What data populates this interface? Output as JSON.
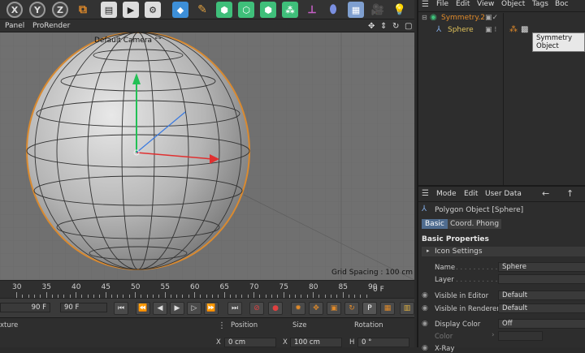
{
  "toolbar": {
    "axis_x": "X",
    "axis_y": "Y",
    "axis_z": "Z"
  },
  "view_header": {
    "panel": "Panel",
    "prorender": "ProRender",
    "camera": "Default Camera",
    "camera_mark": "°°"
  },
  "viewport": {
    "grid_spacing": "Grid Spacing : 100 cm"
  },
  "timeline": {
    "ticks": [
      "30",
      "35",
      "40",
      "45",
      "50",
      "55",
      "60",
      "65",
      "70",
      "75",
      "80",
      "85",
      "90"
    ],
    "end_frame": "0 F"
  },
  "transport": {
    "current_frame": "90 F",
    "end_frame": "90 F"
  },
  "coords": {
    "texture_label": "xture",
    "position": "Position",
    "size": "Size",
    "rotation": "Rotation",
    "x_label": "X",
    "pos_x": "0 cm",
    "x_label2": "X",
    "size_x": "100 cm",
    "h_label": "H",
    "rot_h": "0 °"
  },
  "object_manager": {
    "menu": [
      "File",
      "Edit",
      "View",
      "Object",
      "Tags",
      "Boc"
    ],
    "objects": [
      {
        "name": "Symmetry.2",
        "color": "#e08a2a"
      },
      {
        "name": "Sphere",
        "color": "#e0c25a"
      }
    ],
    "tooltip": "Symmetry Object"
  },
  "attribute_manager": {
    "menu": [
      "Mode",
      "Edit",
      "User Data"
    ],
    "object_title": "Polygon Object [Sphere]",
    "tabs": [
      "Basic",
      "Coord.",
      "Phong"
    ],
    "section": "Basic Properties",
    "icon_settings": "Icon Settings",
    "fields": [
      {
        "label": "Name",
        "dots": ". . . . . . . . . . .",
        "value": "Sphere"
      },
      {
        "label": "Layer",
        "dots": ". . . . . . . . . . .",
        "value": ""
      }
    ],
    "visible_editor_label": "Visible in Editor",
    "visible_editor_value": "Default",
    "visible_renderer_label": "Visible in Renderer",
    "visible_renderer_value": "Default",
    "display_color_label": "Display Color",
    "display_color_value": "Off",
    "color_label": "Color",
    "xray_label": "X-Ray"
  },
  "colors": {
    "accent": "#e08a2a",
    "tab_active": "#4f6c8f",
    "viewport_bg": "#707070"
  }
}
